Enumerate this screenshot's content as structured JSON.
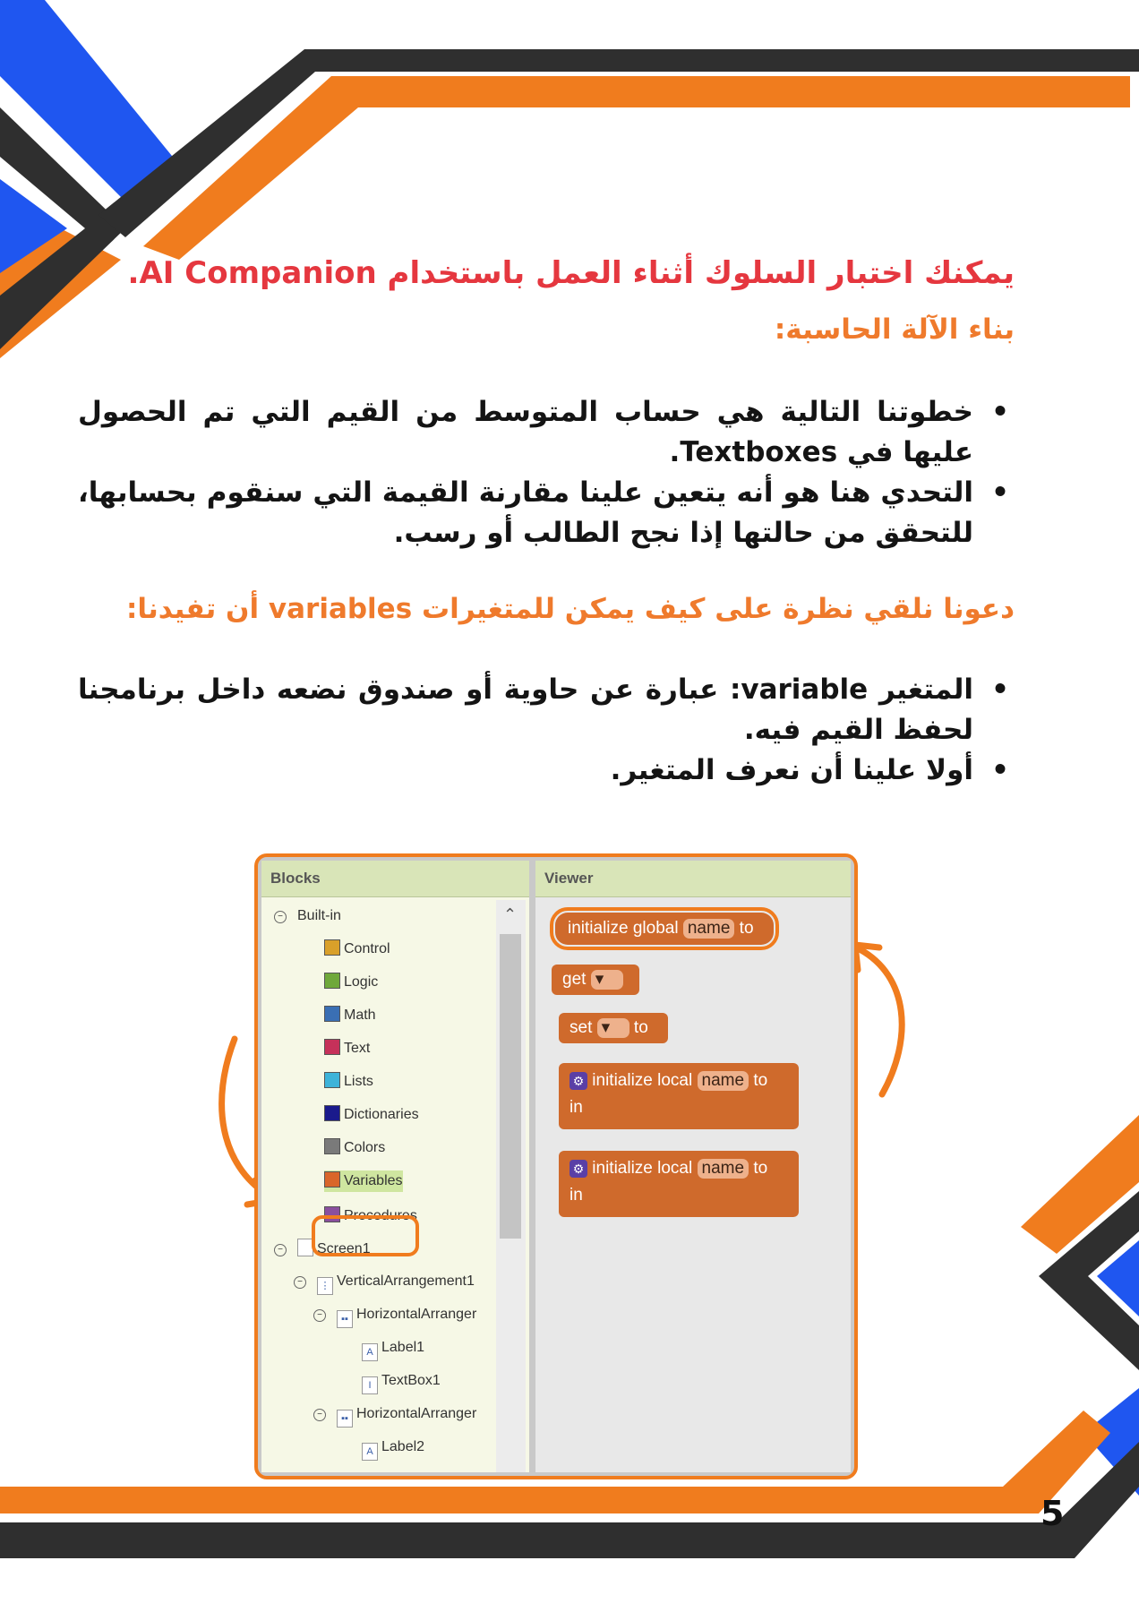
{
  "header": {
    "headline": "يمكنك اختبار السلوك أثناء العمل باستخدام AI Companion.",
    "section_title": "بناء الآلة الحاسبة:"
  },
  "list1": [
    "خطوتنا التالية هي حساب المتوسط من القيم التي تم الحصول عليها في Textboxes.",
    "التحدي هنا هو أنه يتعين علينا مقارنة القيمة التي سنقوم بحسابها، للتحقق من حالتها إذا نجح الطالب أو رسب."
  ],
  "section2_title": "دعونا نلقي نظرة على كيف يمكن للمتغيرات variables أن تفيدنا:",
  "list2": [
    "المتغير variable: عبارة عن حاوية أو صندوق نضعه داخل برنامجنا لحفظ القيم فيه.",
    "أولا علينا أن نعرف المتغير."
  ],
  "page_number": "5",
  "colors": {
    "orange": "#f07c1e",
    "blue": "#1f56f0",
    "dark": "#2f2f2f",
    "red_heading": "#e5373f"
  },
  "screenshot": {
    "blocks_header": "Blocks",
    "viewer_header": "Viewer",
    "builtin_label": "Built-in",
    "categories": [
      {
        "label": "Control",
        "color": "#d9a02a"
      },
      {
        "label": "Logic",
        "color": "#6fa83a"
      },
      {
        "label": "Math",
        "color": "#3a6fb4"
      },
      {
        "label": "Text",
        "color": "#c6315a"
      },
      {
        "label": "Lists",
        "color": "#3db3d9"
      },
      {
        "label": "Dictionaries",
        "color": "#1a1a8c"
      },
      {
        "label": "Colors",
        "color": "#7a7a7a"
      },
      {
        "label": "Variables",
        "color": "#d9662a"
      },
      {
        "label": "Procedures",
        "color": "#8a4f9e"
      }
    ],
    "components": [
      {
        "label": "Screen1"
      },
      {
        "label": "VerticalArrangement1"
      },
      {
        "label": "HorizontalArranger"
      },
      {
        "label": "Label1"
      },
      {
        "label": "TextBox1"
      },
      {
        "label": "HorizontalArranger"
      },
      {
        "label": "Label2"
      }
    ],
    "blocks": {
      "init_global": "initialize global",
      "name": "name",
      "to": "to",
      "get": "get",
      "set": "set",
      "init_local": "initialize local",
      "in": "in"
    }
  }
}
